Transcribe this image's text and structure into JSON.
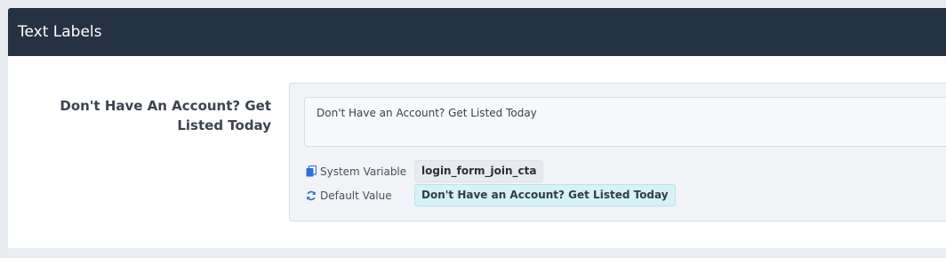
{
  "panel": {
    "title": "Text Labels"
  },
  "field": {
    "label": "Don't Have An Account? Get Listed Today",
    "value": "Don't Have an Account? Get Listed Today",
    "system_variable_label": "System Variable",
    "system_variable_value": "login_form_join_cta",
    "default_value_label": "Default Value",
    "default_value": "Don't Have an Account? Get Listed Today",
    "icons": {
      "system_variable": "copy-icon",
      "default_value": "refresh-icon"
    }
  },
  "colors": {
    "header_bg": "#253244",
    "accent_icon": "#2d6fd6",
    "default_badge_bg": "#d5f2f7"
  }
}
